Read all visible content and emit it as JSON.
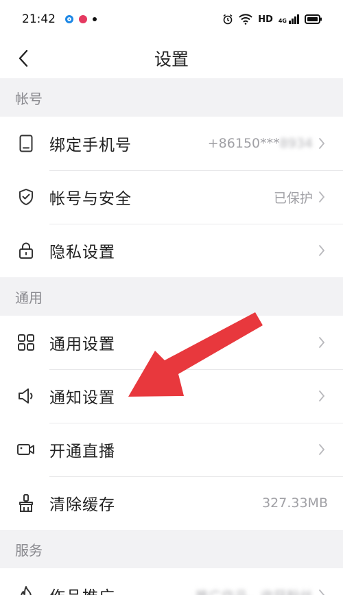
{
  "status_bar": {
    "time": "21:42",
    "network": "HD",
    "signal_label": "4G"
  },
  "nav": {
    "title": "设置"
  },
  "sections": [
    {
      "header": "帐号",
      "rows": [
        {
          "label": "绑定手机号",
          "value": "+86150***",
          "value_blurred": "8934",
          "icon": "phone-icon"
        },
        {
          "label": "帐号与安全",
          "value": "已保护",
          "icon": "shield-check-icon"
        },
        {
          "label": "隐私设置",
          "value": "",
          "icon": "lock-icon"
        }
      ]
    },
    {
      "header": "通用",
      "rows": [
        {
          "label": "通用设置",
          "value": "",
          "icon": "grid-icon"
        },
        {
          "label": "通知设置",
          "value": "",
          "icon": "speaker-icon"
        },
        {
          "label": "开通直播",
          "value": "",
          "icon": "video-camera-icon"
        },
        {
          "label": "清除缓存",
          "value": "327.33MB",
          "icon": "brush-icon"
        }
      ]
    },
    {
      "header": "服务",
      "rows": [
        {
          "label": "作品推广",
          "value": "推广作品，收获粉丝",
          "icon": "flame-icon"
        }
      ]
    }
  ],
  "colors": {
    "accent_arrow": "#e8383d",
    "background": "#f2f2f4",
    "row_bg": "#ffffff",
    "muted_text": "#a0a0a5"
  }
}
